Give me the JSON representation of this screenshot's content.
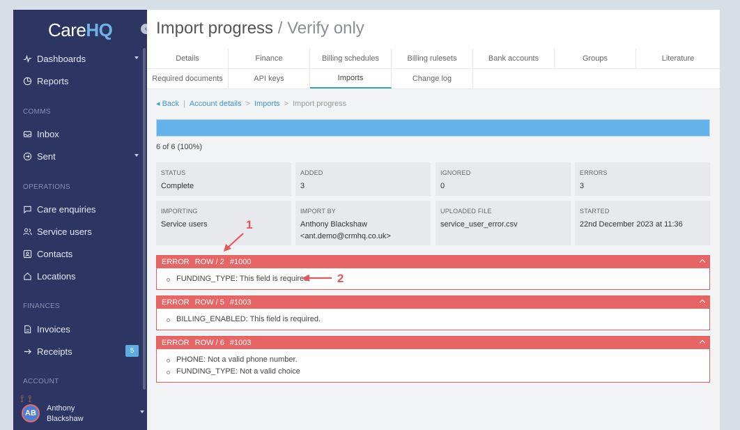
{
  "sidebar": {
    "logo": {
      "care": "Care",
      "hq": "HQ"
    },
    "items_top": [
      {
        "label": "Dashboards",
        "icon": "activity-icon",
        "caret": true
      },
      {
        "label": "Reports",
        "icon": "pie-chart-icon"
      }
    ],
    "sections": {
      "comms": "COMMS",
      "operations": "OPERATIONS",
      "finances": "FINANCES",
      "account": "ACCOUNT"
    },
    "comms": [
      {
        "label": "Inbox",
        "icon": "inbox-icon"
      },
      {
        "label": "Sent",
        "icon": "arrow-circle-icon",
        "caret": true
      }
    ],
    "operations": [
      {
        "label": "Care enquiries",
        "icon": "chat-icon"
      },
      {
        "label": "Service users",
        "icon": "users-icon"
      },
      {
        "label": "Contacts",
        "icon": "contact-card-icon"
      },
      {
        "label": "Locations",
        "icon": "home-icon"
      }
    ],
    "finances": [
      {
        "label": "Invoices",
        "icon": "file-icon"
      },
      {
        "label": "Receipts",
        "icon": "arrow-right-icon",
        "badge": "5"
      }
    ],
    "user": {
      "initials": "AB",
      "name_line1": "Anthony",
      "name_line2": "Blackshaw"
    }
  },
  "page": {
    "title": "Import progress",
    "subtitle": " / Verify only"
  },
  "tabs": {
    "row1": [
      "Details",
      "Finance",
      "Billing schedules",
      "Billing rulesets",
      "Bank accounts",
      "Groups",
      "Literature"
    ],
    "row2": [
      "Required documents",
      "API keys",
      "Imports",
      "Change log"
    ],
    "active": "Imports"
  },
  "breadcrumb": {
    "back": "Back",
    "account": "Account details",
    "imports": "Imports",
    "current": "Import progress"
  },
  "progress": {
    "value": 1.0,
    "text": "6 of 6 (100%)"
  },
  "stats": [
    {
      "key": "STATUS",
      "value": "Complete"
    },
    {
      "key": "ADDED",
      "value": "3"
    },
    {
      "key": "IGNORED",
      "value": "0"
    },
    {
      "key": "ERRORS",
      "value": "3"
    },
    {
      "key": "IMPORTING",
      "value": "Service users"
    },
    {
      "key": "IMPORT BY",
      "value": "Anthony Blackshaw",
      "value2": "<ant.demo@crmhq.co.uk>"
    },
    {
      "key": "UPLOADED FILE",
      "value": "service_user_error.csv"
    },
    {
      "key": "STARTED",
      "value": "22nd December 2023 at 11:36"
    }
  ],
  "errors": [
    {
      "label": "ERROR",
      "row": "ROW / 2",
      "id": "#1000",
      "messages": [
        "FUNDING_TYPE: This field is required."
      ]
    },
    {
      "label": "ERROR",
      "row": "ROW / 5",
      "id": "#1003",
      "messages": [
        "BILLING_ENABLED: This field is required."
      ]
    },
    {
      "label": "ERROR",
      "row": "ROW / 6",
      "id": "#1003",
      "messages": [
        "PHONE: Not a valid phone number.",
        "FUNDING_TYPE: Not a valid choice"
      ]
    }
  ],
  "annotations": {
    "one": "1",
    "two": "2"
  },
  "colors": {
    "sidebar": "#2d3563",
    "accent": "#65b3ec",
    "error": "#e86565",
    "annotation": "#e4585d"
  }
}
